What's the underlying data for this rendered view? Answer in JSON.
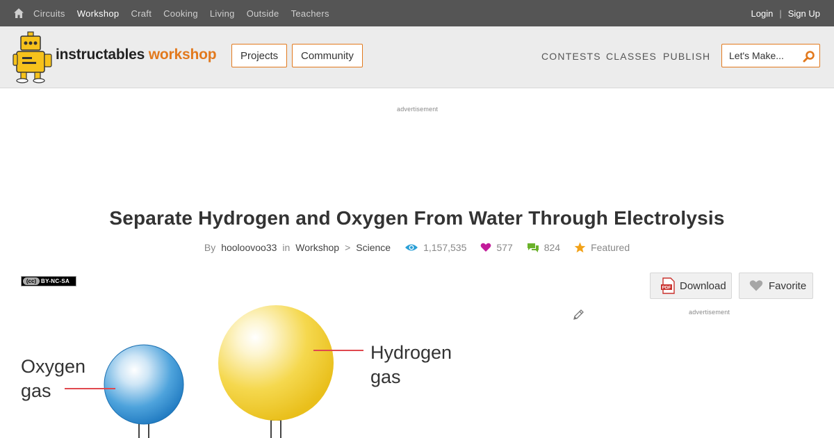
{
  "topbar": {
    "nav": [
      "Circuits",
      "Workshop",
      "Craft",
      "Cooking",
      "Living",
      "Outside",
      "Teachers"
    ],
    "active": "Workshop",
    "login": "Login",
    "separator": "|",
    "signup": "Sign Up"
  },
  "header": {
    "logo_word": "instructables",
    "logo_section": "workshop",
    "projects_label": "Projects",
    "community_label": "Community",
    "contests_label": "CONTESTS",
    "classes_label": "CLASSES",
    "publish_label": "PUBLISH",
    "search_placeholder": "Let's Make..."
  },
  "ads": {
    "top_label": "advertisement",
    "side_label": "advertisement"
  },
  "article": {
    "title": "Separate Hydrogen and Oxygen From Water Through Electrolysis",
    "by": "By",
    "author": "hooloovoo33",
    "in": "in",
    "category": "Workshop",
    "arrow": ">",
    "subcategory": "Science",
    "views": "1,157,535",
    "favorites": "577",
    "comments": "824",
    "featured": "Featured",
    "license_c": "(cc)",
    "license": "BY-NC-SA",
    "download_label": "Download",
    "favorite_label": "Favorite",
    "pdf_badge": "PDF"
  },
  "diagram": {
    "oxygen_label_1": "Oxygen",
    "oxygen_label_2": "gas",
    "hydrogen_label_1": "Hydrogen",
    "hydrogen_label_2": "gas"
  },
  "colors": {
    "accent": "#e2791d",
    "topbar": "#555555",
    "views_icon": "#2a9fd6",
    "favorites_icon": "#c21c9a",
    "comments_icon": "#6ab22a",
    "featured_icon": "#f2a218"
  }
}
